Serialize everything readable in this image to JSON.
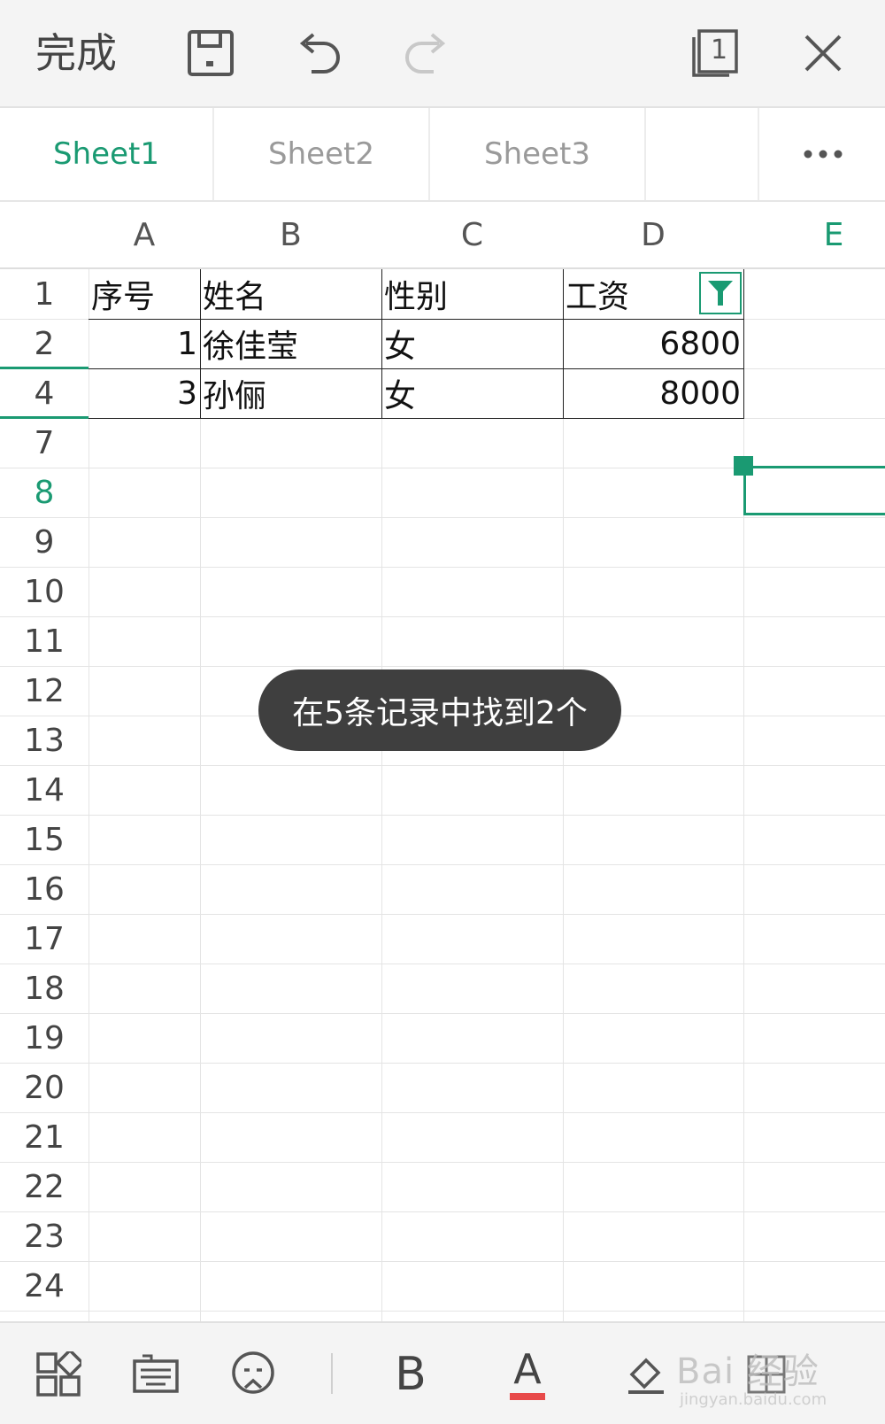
{
  "toolbar": {
    "done_label": "完成",
    "window_count": "1"
  },
  "sheet_tabs": [
    {
      "label": "Sheet1",
      "active": true
    },
    {
      "label": "Sheet2",
      "active": false
    },
    {
      "label": "Sheet3",
      "active": false
    }
  ],
  "more_label": "•••",
  "columns": [
    "A",
    "B",
    "C",
    "D",
    "E"
  ],
  "rows": [
    "1",
    "2",
    "4",
    "7",
    "8",
    "9",
    "10",
    "11",
    "12",
    "13",
    "14",
    "15",
    "16",
    "17",
    "18",
    "19",
    "20",
    "21",
    "22",
    "23",
    "24"
  ],
  "table": {
    "headers": [
      "序号",
      "姓名",
      "性别",
      "工资"
    ],
    "data": [
      [
        "1",
        "徐佳莹",
        "女",
        "6800"
      ],
      [
        "3",
        "孙俪",
        "女",
        "8000"
      ]
    ]
  },
  "toast": "在5条记录中找到2个",
  "bottom_toolbar": {
    "bold_label": "B",
    "font_color_label": "A",
    "font_color": "#e84a4a"
  },
  "watermark": {
    "text": "Bai 经验",
    "sub": "jingyan.baidu.com"
  },
  "colors": {
    "accent": "#1a9a72"
  }
}
